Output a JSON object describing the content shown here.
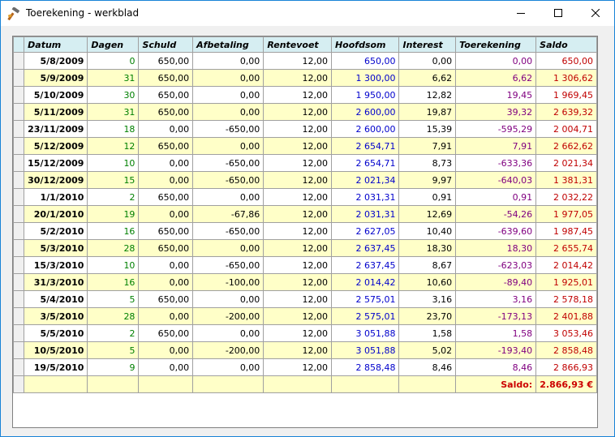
{
  "window": {
    "title": "Toerekening - werkblad"
  },
  "colors": {
    "green": "#008000",
    "blue": "#0000cc",
    "purple": "#800080",
    "red": "#c00000",
    "header_bg": "#d6eef2",
    "alt_row": "#ffffc8"
  },
  "table": {
    "headers": [
      "Datum",
      "Dagen",
      "Schuld",
      "Afbetaling",
      "Rentevoet",
      "Hoofdsom",
      "Interest",
      "Toerekening",
      "Saldo"
    ],
    "rows": [
      [
        "5/8/2009",
        "0",
        "650,00",
        "0,00",
        "12,00",
        "650,00",
        "0,00",
        "0,00",
        "650,00"
      ],
      [
        "5/9/2009",
        "31",
        "650,00",
        "0,00",
        "12,00",
        "1 300,00",
        "6,62",
        "6,62",
        "1 306,62"
      ],
      [
        "5/10/2009",
        "30",
        "650,00",
        "0,00",
        "12,00",
        "1 950,00",
        "12,82",
        "19,45",
        "1 969,45"
      ],
      [
        "5/11/2009",
        "31",
        "650,00",
        "0,00",
        "12,00",
        "2 600,00",
        "19,87",
        "39,32",
        "2 639,32"
      ],
      [
        "23/11/2009",
        "18",
        "0,00",
        "-650,00",
        "12,00",
        "2 600,00",
        "15,39",
        "-595,29",
        "2 004,71"
      ],
      [
        "5/12/2009",
        "12",
        "650,00",
        "0,00",
        "12,00",
        "2 654,71",
        "7,91",
        "7,91",
        "2 662,62"
      ],
      [
        "15/12/2009",
        "10",
        "0,00",
        "-650,00",
        "12,00",
        "2 654,71",
        "8,73",
        "-633,36",
        "2 021,34"
      ],
      [
        "30/12/2009",
        "15",
        "0,00",
        "-650,00",
        "12,00",
        "2 021,34",
        "9,97",
        "-640,03",
        "1 381,31"
      ],
      [
        "1/1/2010",
        "2",
        "650,00",
        "0,00",
        "12,00",
        "2 031,31",
        "0,91",
        "0,91",
        "2 032,22"
      ],
      [
        "20/1/2010",
        "19",
        "0,00",
        "-67,86",
        "12,00",
        "2 031,31",
        "12,69",
        "-54,26",
        "1 977,05"
      ],
      [
        "5/2/2010",
        "16",
        "650,00",
        "-650,00",
        "12,00",
        "2 627,05",
        "10,40",
        "-639,60",
        "1 987,45"
      ],
      [
        "5/3/2010",
        "28",
        "650,00",
        "0,00",
        "12,00",
        "2 637,45",
        "18,30",
        "18,30",
        "2 655,74"
      ],
      [
        "15/3/2010",
        "10",
        "0,00",
        "-650,00",
        "12,00",
        "2 637,45",
        "8,67",
        "-623,03",
        "2 014,42"
      ],
      [
        "31/3/2010",
        "16",
        "0,00",
        "-100,00",
        "12,00",
        "2 014,42",
        "10,60",
        "-89,40",
        "1 925,01"
      ],
      [
        "5/4/2010",
        "5",
        "650,00",
        "0,00",
        "12,00",
        "2 575,01",
        "3,16",
        "3,16",
        "2 578,18"
      ],
      [
        "3/5/2010",
        "28",
        "0,00",
        "-200,00",
        "12,00",
        "2 575,01",
        "23,70",
        "-173,13",
        "2 401,88"
      ],
      [
        "5/5/2010",
        "2",
        "650,00",
        "0,00",
        "12,00",
        "3 051,88",
        "1,58",
        "1,58",
        "3 053,46"
      ],
      [
        "10/5/2010",
        "5",
        "0,00",
        "-200,00",
        "12,00",
        "3 051,88",
        "5,02",
        "-193,40",
        "2 858,48"
      ],
      [
        "19/5/2010",
        "9",
        "0,00",
        "0,00",
        "12,00",
        "2 858,48",
        "8,46",
        "8,46",
        "2 866,93"
      ]
    ]
  },
  "footer": {
    "saldo_label": "Saldo:",
    "saldo_value": "2.866,93 €"
  }
}
